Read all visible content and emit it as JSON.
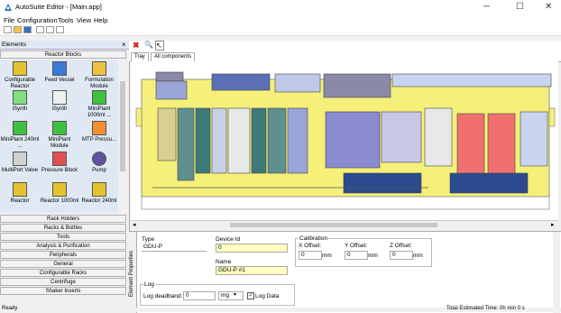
{
  "window": {
    "title": "AutoSuite Editor - [Main.app]",
    "controls": {
      "minimize": "─",
      "maximize": "☐",
      "close": "✕"
    }
  },
  "menu": [
    "File",
    "Configuration",
    "Tools",
    "View",
    "Help"
  ],
  "left_panel": {
    "header": "Elements",
    "close": "×",
    "category_open": "Reactor Blocks",
    "palette": [
      {
        "label": "Configurable Reactor",
        "icon": "configurable-reactor-icon"
      },
      {
        "label": "Feed Vessel",
        "icon": "feed-vessel-icon"
      },
      {
        "label": "Formulation Module",
        "icon": "formulation-module-icon"
      },
      {
        "label": "iSynth",
        "icon": "isynth-icon"
      },
      {
        "label": "iSynth",
        "icon": "isynth-icon"
      },
      {
        "label": "MiniPlant 1000ml ...",
        "icon": "miniplant-icon"
      },
      {
        "label": "MiniPlant 240ml ...",
        "icon": "miniplant-icon"
      },
      {
        "label": "MiniPlant Module",
        "icon": "miniplant-module-icon"
      },
      {
        "label": "MTP Pressu...",
        "icon": "mtp-pressure-icon"
      },
      {
        "label": "MultiPort Valve",
        "icon": "multiport-valve-icon"
      },
      {
        "label": "Pressure Block",
        "icon": "pressure-block-icon"
      },
      {
        "label": "Pump",
        "icon": "pump-icon"
      },
      {
        "label": "Reactor",
        "icon": "reactor-icon"
      },
      {
        "label": "Reactor 1000ml",
        "icon": "reactor-icon"
      },
      {
        "label": "Reactor 240ml",
        "icon": "reactor-icon"
      }
    ],
    "categories": [
      "Rack Holders",
      "Racks & Bottles",
      "Tools",
      "Analysis & Purification",
      "Peripherals",
      "General",
      "Configurable Racks",
      "Centrifuge",
      "Shaker Inserts"
    ]
  },
  "tabs": [
    "Tray",
    "All components"
  ],
  "properties": {
    "side_label": "Element Properties",
    "type_label": "Type",
    "type_value": "GDU-P",
    "device_id_label": "Device Id",
    "device_id_value": "0",
    "name_label": "Name",
    "name_value": "GDU-P #1",
    "calibration_label": "Calibration",
    "x_offset_label": "X Offset:",
    "x_offset_value": "0",
    "y_offset_label": "Y Offset:",
    "y_offset_value": "0",
    "z_offset_label": "Z Offset:",
    "z_offset_value": "0",
    "unit": "mm",
    "log_label": "Log",
    "log_deadband_label": "Log deadband:",
    "log_deadband_value": "0",
    "log_unit": "mg",
    "log_data_label": "Log Data",
    "log_data_checked": true
  },
  "status": {
    "left": "Ready",
    "right": "Total Estimated Time: 0h min 0 s"
  }
}
